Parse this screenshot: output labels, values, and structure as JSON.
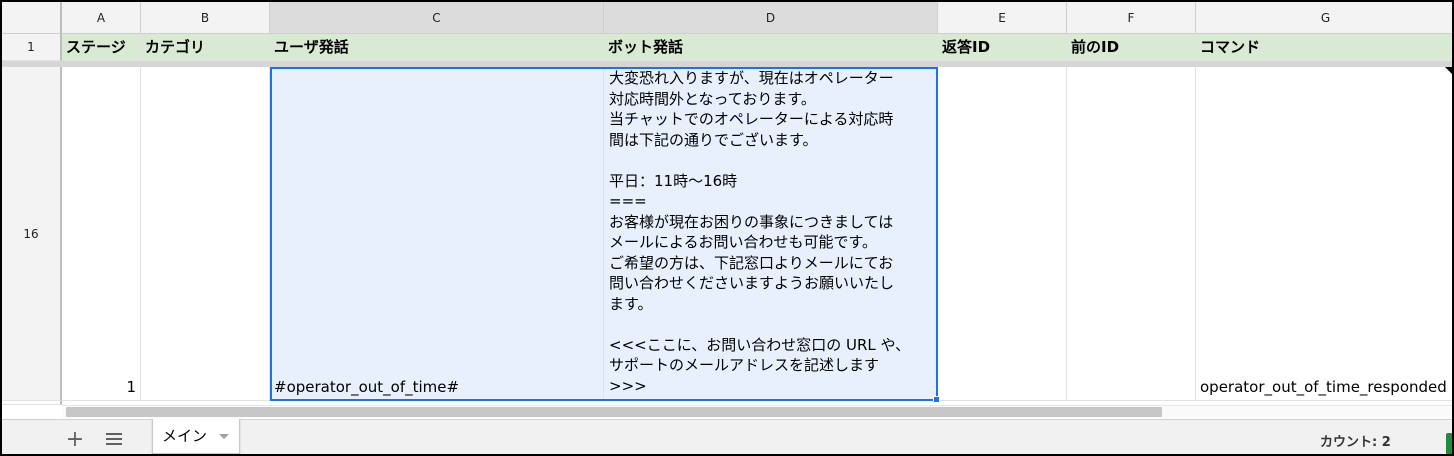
{
  "columns": [
    "A",
    "B",
    "C",
    "D",
    "E",
    "F",
    "G"
  ],
  "rows": {
    "header": "1",
    "current": "16"
  },
  "header_row": {
    "A": "ステージ",
    "B": "カテゴリ",
    "C": "ユーザ発話",
    "D": "ボット発話",
    "E": "返答ID",
    "F": "前のID",
    "G": "コマンド"
  },
  "row16": {
    "A": "1",
    "B": "",
    "C": "#operator_out_of_time#",
    "D": "大変恐れ入りますが、現在はオペレーター\n対応時間外となっております。\n当チャットでのオペレーターによる対応時\n間は下記の通りでございます。\n\n平日：11時〜16時\n===\nお客様が現在お困りの事象につきましては\nメールによるお問い合わせも可能です。\nご希望の方は、下記窓口よりメールにてお\n問い合わせくださいますようお願いいたし\nます。\n\n<<<ここに、お問い合わせ窓口の URL や、\nサポートのメールアドレスを記述します\n>>>",
    "E": "",
    "F": "",
    "G": "operator_out_of_time_responded"
  },
  "sheet_tabs": {
    "active": "メイン"
  },
  "status": {
    "count": "カウント: 2"
  },
  "colors": {
    "header_fill": "#d9ead3",
    "selection": "#1a73e8",
    "selected_fill": "#e8f0fe"
  },
  "icons": {
    "add_sheet": "plus-icon",
    "sheet_list": "list-icon",
    "tab_menu": "caret-down-icon"
  }
}
